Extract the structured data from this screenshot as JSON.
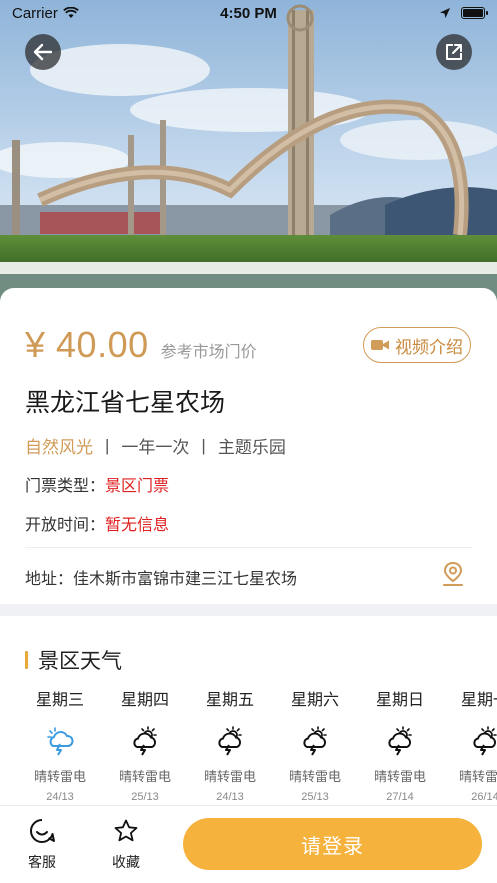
{
  "status_bar": {
    "carrier": "Carrier",
    "time": "4:50 PM"
  },
  "hero": {
    "back_icon": "arrow-left-icon",
    "share_icon": "external-link-icon"
  },
  "ticket": {
    "price": "¥ 40.00",
    "price_note": "参考市场门价",
    "video_button": "视频介绍",
    "name": "黑龙江省七星农场",
    "tags": [
      "自然风光",
      "一年一次",
      "主题乐园"
    ],
    "ticket_type_label": "门票类型：",
    "ticket_type_value": "景区门票",
    "open_time_label": "开放时间：",
    "open_time_value": "暂无信息",
    "address_label": "地址：",
    "address_value": "佳木斯市富锦市建三江七星农场"
  },
  "weather": {
    "section_title": "景区天气",
    "days": [
      {
        "name": "星期三",
        "desc": "晴转雷电",
        "temp": "24/13",
        "icon": "thunder-cloud-icon-blue"
      },
      {
        "name": "星期四",
        "desc": "晴转雷电",
        "temp": "25/13",
        "icon": "sun-thunder-cloud-icon"
      },
      {
        "name": "星期五",
        "desc": "晴转雷电",
        "temp": "24/13",
        "icon": "sun-thunder-cloud-icon"
      },
      {
        "name": "星期六",
        "desc": "晴转雷电",
        "temp": "25/13",
        "icon": "sun-thunder-cloud-icon"
      },
      {
        "name": "星期日",
        "desc": "晴转雷电",
        "temp": "27/14",
        "icon": "sun-thunder-cloud-icon"
      },
      {
        "name": "星期一",
        "desc": "晴转雷电",
        "temp": "26/14",
        "icon": "sun-thunder-cloud-icon"
      }
    ]
  },
  "bottom_bar": {
    "service_label": "客服",
    "favorite_label": "收藏",
    "login_label": "请登录"
  },
  "colors": {
    "accent_gold": "#cf9a55",
    "login_orange": "#f5b23c",
    "alert_red": "#e02020"
  }
}
